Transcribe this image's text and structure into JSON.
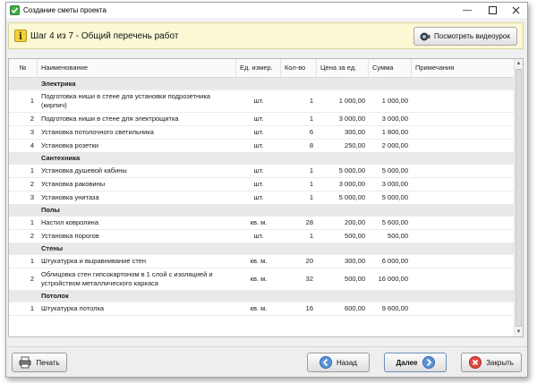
{
  "window": {
    "title": "Создание сметы проекта"
  },
  "banner": {
    "step_text": "Шаг 4 из 7 - Общий перечень работ",
    "video_button": "Посмотреть видеоурок"
  },
  "table": {
    "columns": [
      "№",
      "Наименование",
      "Ед. измер.",
      "Кол-во",
      "Цена за ед.",
      "Сумма",
      "Примечания"
    ],
    "rows": [
      {
        "type": "category",
        "name": "Электрика"
      },
      {
        "type": "item",
        "num": "1",
        "name": "Подготовка ниши в стене для установки подрозетника (кирпич)",
        "unit": "шт.",
        "qty": "1",
        "price": "1 000,00",
        "sum": "1 000,00",
        "note": ""
      },
      {
        "type": "item",
        "num": "2",
        "name": "Подготовка ниши в стене для электрощитка",
        "unit": "шт.",
        "qty": "1",
        "price": "3 000,00",
        "sum": "3 000,00",
        "note": ""
      },
      {
        "type": "item",
        "num": "3",
        "name": "Установка потолочного светильника",
        "unit": "шт.",
        "qty": "6",
        "price": "300,00",
        "sum": "1 800,00",
        "note": ""
      },
      {
        "type": "item",
        "num": "4",
        "name": "Установка розетки",
        "unit": "шт.",
        "qty": "8",
        "price": "250,00",
        "sum": "2 000,00",
        "note": ""
      },
      {
        "type": "category",
        "name": "Сантехника"
      },
      {
        "type": "item",
        "num": "1",
        "name": "Установка душевой кабины",
        "unit": "шт.",
        "qty": "1",
        "price": "5 000,00",
        "sum": "5 000,00",
        "note": ""
      },
      {
        "type": "item",
        "num": "2",
        "name": "Установка раковины",
        "unit": "шт.",
        "qty": "1",
        "price": "3 000,00",
        "sum": "3 000,00",
        "note": ""
      },
      {
        "type": "item",
        "num": "3",
        "name": "Установка унитаза",
        "unit": "шт.",
        "qty": "1",
        "price": "5 000,00",
        "sum": "5 000,00",
        "note": ""
      },
      {
        "type": "category",
        "name": "Полы"
      },
      {
        "type": "item",
        "num": "1",
        "name": "Настил ковролина",
        "unit": "кв. м.",
        "qty": "28",
        "price": "200,00",
        "sum": "5 600,00",
        "note": ""
      },
      {
        "type": "item",
        "num": "2",
        "name": "Установка порогов",
        "unit": "шт.",
        "qty": "1",
        "price": "500,00",
        "sum": "500,00",
        "note": ""
      },
      {
        "type": "category",
        "name": "Стены"
      },
      {
        "type": "item",
        "num": "1",
        "name": "Штукатурка и выравнивание стен",
        "unit": "кв. м.",
        "qty": "20",
        "price": "300,00",
        "sum": "6 000,00",
        "note": ""
      },
      {
        "type": "item",
        "num": "2",
        "name": "Облицовка стен гипсокартоном в 1 слой с изоляцией и устройством металлического каркаса",
        "unit": "кв. м.",
        "qty": "32",
        "price": "500,00",
        "sum": "16 000,00",
        "note": ""
      },
      {
        "type": "category",
        "name": "Потолок"
      },
      {
        "type": "item",
        "num": "1",
        "name": "Штукатурка потолка",
        "unit": "кв. м.",
        "qty": "16",
        "price": "600,00",
        "sum": "9 600,00",
        "note": ""
      }
    ]
  },
  "footer": {
    "print": "Печать",
    "back": "Назад",
    "next": "Далее",
    "close": "Закрыть"
  }
}
